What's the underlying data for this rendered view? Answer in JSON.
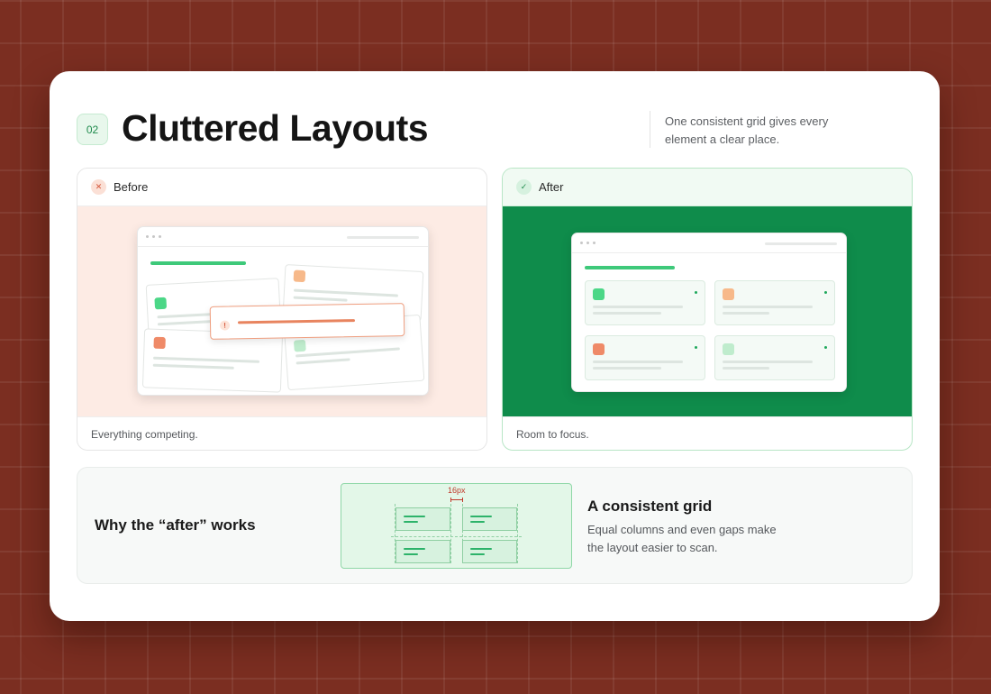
{
  "header": {
    "step": "02",
    "title": "Cluttered Layouts",
    "description": "One consistent grid gives every element a clear place."
  },
  "before": {
    "label": "Before",
    "status_icon": "x-icon",
    "alert_icon_glyph": "!",
    "caption": "Everything competing."
  },
  "after": {
    "label": "After",
    "status_icon": "check-icon",
    "caption": "Room to focus."
  },
  "why": {
    "title": "Why the “after” works",
    "gap_label": "16px",
    "heading": "A consistent grid",
    "description": "Equal columns and even gaps make the layout easier to scan."
  },
  "colors": {
    "background": "#7b2e21",
    "accent_green": "#0f8c4b",
    "before_bg": "#fdebe4",
    "warning": "#e8845f"
  }
}
